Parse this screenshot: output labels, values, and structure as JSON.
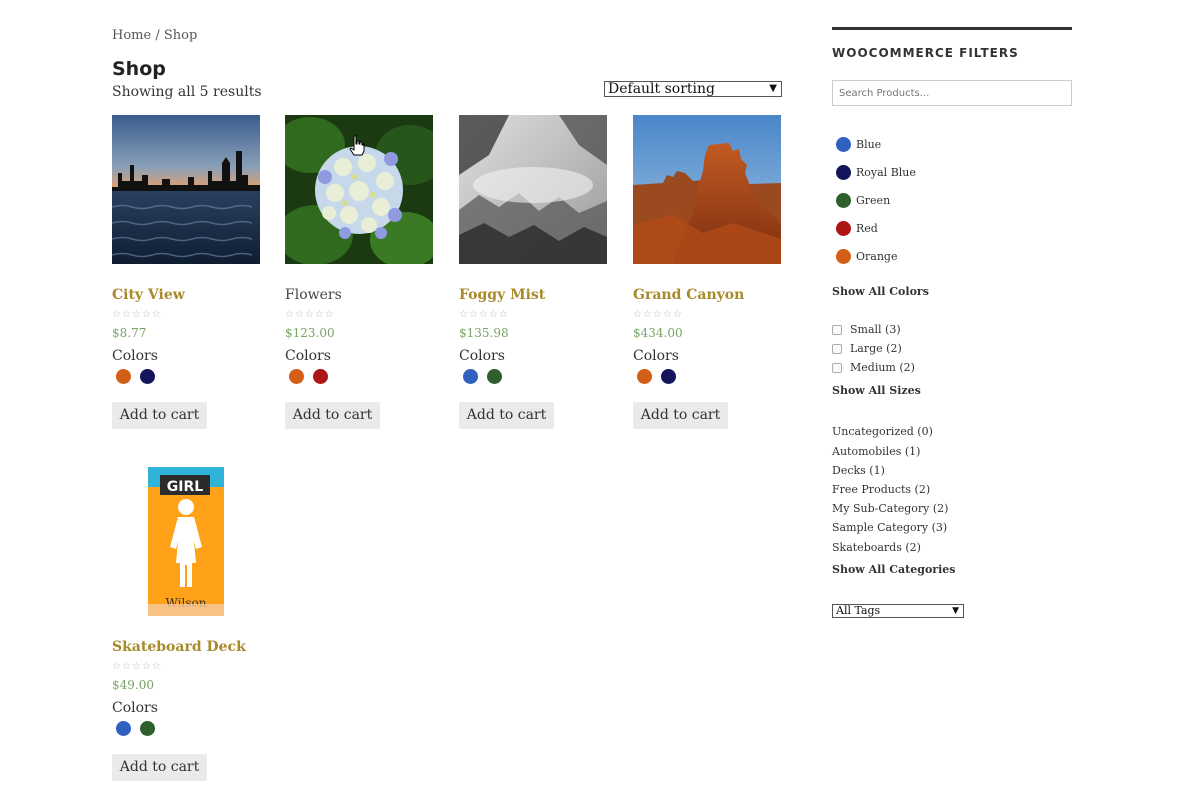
{
  "breadcrumb": {
    "home": "Home",
    "sep": " / ",
    "current": "Shop"
  },
  "page": {
    "title": "Shop",
    "result_count": "Showing all 5 results",
    "sort": "Default sorting"
  },
  "swatch_colors": {
    "blue": "#3060c0",
    "royal_blue": "#14145a",
    "green": "#2f5f2c",
    "red": "#b01515",
    "orange": "#d35e16"
  },
  "products": [
    {
      "name": "City View",
      "price": "$8.77",
      "colors_label": "Colors",
      "cart": "Add to cart",
      "colors": [
        "orange",
        "royal-blue"
      ]
    },
    {
      "name": "Flowers",
      "price": "$123.00",
      "colors_label": "Colors",
      "cart": "Add to cart",
      "colors": [
        "orange",
        "red"
      ]
    },
    {
      "name": "Foggy Mist",
      "price": "$135.98",
      "colors_label": "Colors",
      "cart": "Add to cart",
      "colors": [
        "blue",
        "green"
      ]
    },
    {
      "name": "Grand Canyon",
      "price": "$434.00",
      "colors_label": "Colors",
      "cart": "Add to cart",
      "colors": [
        "orange",
        "royal-blue"
      ]
    },
    {
      "name": "Skateboard Deck",
      "price": "$49.00",
      "colors_label": "Colors",
      "cart": "Add to cart",
      "colors": [
        "blue",
        "green"
      ]
    }
  ],
  "deck_art": {
    "brand": "GIRL",
    "signature": "Wilson"
  },
  "sidebar": {
    "title": "WOOCOMMERCE FILTERS",
    "search_placeholder": "Search Products...",
    "colors": [
      "Blue",
      "Royal Blue",
      "Green",
      "Red",
      "Orange"
    ],
    "show_all_colors": "Show All Colors",
    "sizes": [
      "Small (3)",
      "Large (2)",
      "Medium (2)"
    ],
    "show_all_sizes": "Show All Sizes",
    "categories": [
      "Uncategorized (0)",
      "Automobiles (1)",
      "Decks (1)",
      "Free Products (2)",
      "My Sub-Category (2)",
      "Sample Category (3)",
      "Skateboards (2)"
    ],
    "show_all_categories": "Show All Categories",
    "tags": "All Tags"
  }
}
